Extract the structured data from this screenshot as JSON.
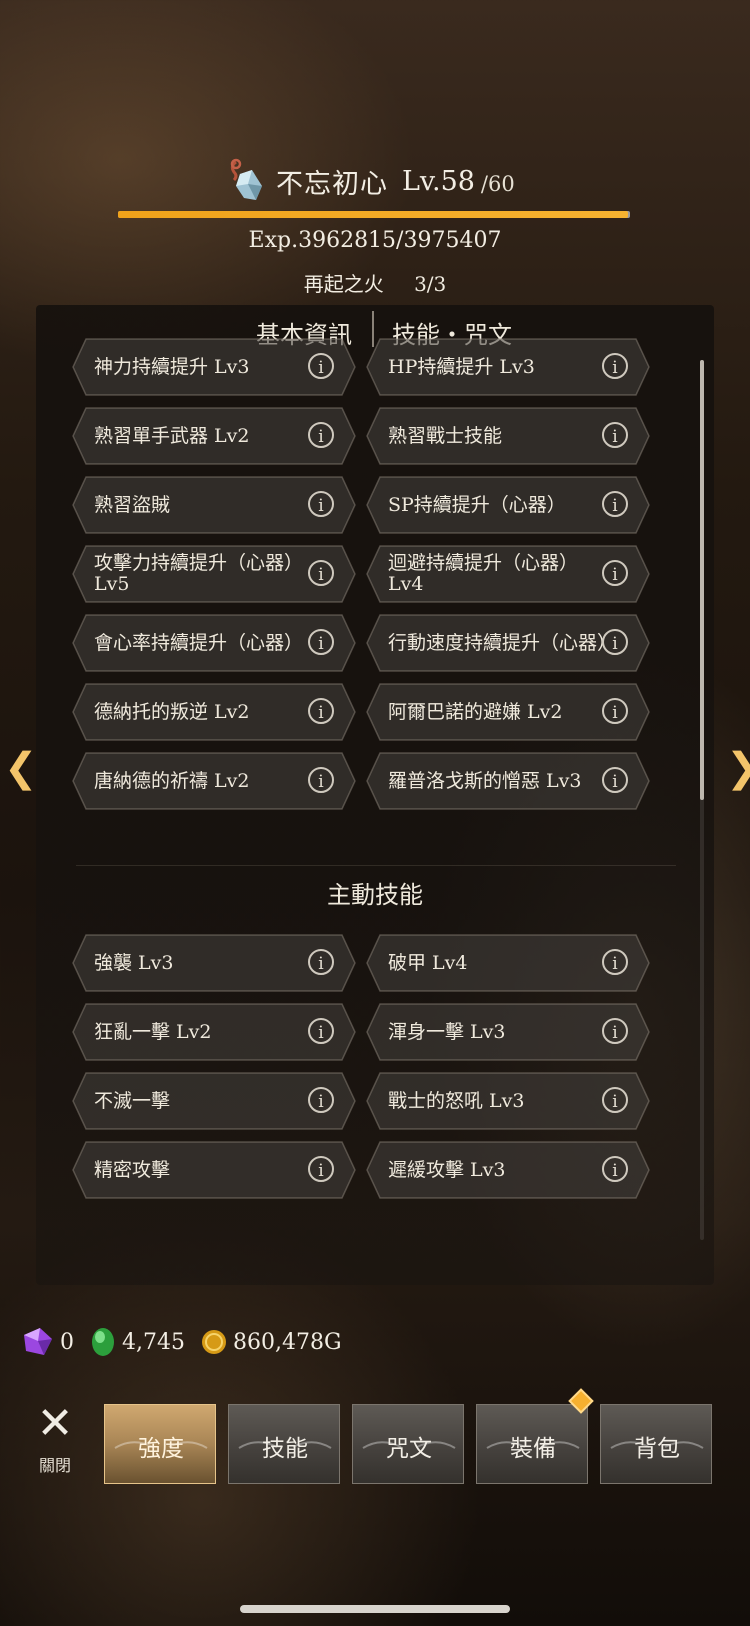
{
  "header": {
    "character_icon": "crystal-charm-icon",
    "name": "不忘初心",
    "level_label": "Lv.",
    "level": "58",
    "level_max": "/60",
    "exp_text": "Exp.3962815/3975407",
    "exp_progress": 0.9968,
    "rebirth_label": "再起之火",
    "rebirth_value": "3/3"
  },
  "tabs": {
    "basic": "基本資訊",
    "skills": "技能・咒文"
  },
  "passive_skills": [
    {
      "label": "神力持續提升 Lv3"
    },
    {
      "label": "HP持續提升 Lv3"
    },
    {
      "label": "熟習單手武器 Lv2"
    },
    {
      "label": "熟習戰士技能"
    },
    {
      "label": "熟習盜賊"
    },
    {
      "label": "SP持續提升（心器）"
    },
    {
      "label": "攻擊力持續提升（心器）Lv5"
    },
    {
      "label": "迴避持續提升（心器）Lv4"
    },
    {
      "label": "會心率持續提升（心器）"
    },
    {
      "label": "行動速度持續提升（心器）"
    },
    {
      "label": "德納托的叛逆 Lv2"
    },
    {
      "label": "阿爾巴諾的避嫌 Lv2"
    },
    {
      "label": "唐納德的祈禱 Lv2"
    },
    {
      "label": "羅普洛戈斯的憎惡 Lv3"
    }
  ],
  "active_section_title": "主動技能",
  "active_skills": [
    {
      "label": "強襲 Lv3"
    },
    {
      "label": "破甲 Lv4"
    },
    {
      "label": "狂亂一擊 Lv2"
    },
    {
      "label": "渾身一擊 Lv3"
    },
    {
      "label": "不滅一擊"
    },
    {
      "label": "戰士的怒吼 Lv3"
    },
    {
      "label": "精密攻擊"
    },
    {
      "label": "遲緩攻擊 Lv3"
    }
  ],
  "info_glyph": "i",
  "navigation": {
    "prev_glyph": "❮",
    "next_glyph": "❯"
  },
  "currency": {
    "purple_gem": "0",
    "green_gem": "4,745",
    "gold": "860,478G",
    "colors": {
      "purple": "#b061f0",
      "green": "#3cc94a",
      "gold": "#e0a21c"
    }
  },
  "bottom_menu": {
    "close_glyph": "✕",
    "close_label": "關閉",
    "buttons": [
      "強度",
      "技能",
      "咒文",
      "裝備",
      "背包"
    ],
    "active_index": 0,
    "badge_on_index": 3
  },
  "colors": {
    "xp_fill": "#f0a21a",
    "accent": "#f3c46a"
  }
}
